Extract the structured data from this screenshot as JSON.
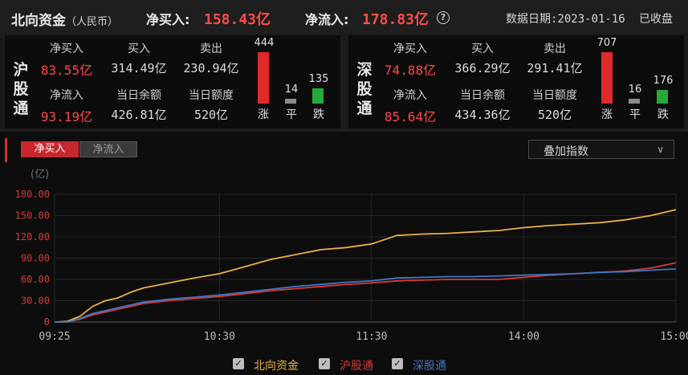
{
  "header": {
    "title": "北向资金",
    "title_suffix": "（人民币）",
    "net_buy_label": "净买入:",
    "net_buy_value": "158.43亿",
    "net_inflow_label": "净流入:",
    "net_inflow_value": "178.83亿",
    "date_label": "数据日期:2023-01-16",
    "status": "已收盘"
  },
  "sh": {
    "name": "沪股通",
    "net_buy_label": "净买入",
    "net_buy": "83.55亿",
    "buy_label": "买入",
    "buy": "314.49亿",
    "sell_label": "卖出",
    "sell": "230.94亿",
    "net_inflow_label": "净流入",
    "net_inflow": "93.19亿",
    "balance_label": "当日余额",
    "balance": "426.81亿",
    "quota_label": "当日额度",
    "quota": "520亿",
    "up": "444",
    "flat": "14",
    "down": "135",
    "up_label": "涨",
    "flat_label": "平",
    "down_label": "跌"
  },
  "sz": {
    "name": "深股通",
    "net_buy_label": "净买入",
    "net_buy": "74.88亿",
    "buy_label": "买入",
    "buy": "366.29亿",
    "sell_label": "卖出",
    "sell": "291.41亿",
    "net_inflow_label": "净流入",
    "net_inflow": "85.64亿",
    "balance_label": "当日余额",
    "balance": "434.36亿",
    "quota_label": "当日额度",
    "quota": "520亿",
    "up": "707",
    "flat": "16",
    "down": "176",
    "up_label": "涨",
    "flat_label": "平",
    "down_label": "跌"
  },
  "controls": {
    "tab_net_buy": "净买入",
    "tab_net_inflow": "净流入",
    "overlay_index": "叠加指数"
  },
  "colors": {
    "up": "#e02a2a",
    "flat": "#8a8a8a",
    "down": "#27a83a",
    "north": "#e8b04a",
    "sh": "#d63a3a",
    "sz": "#3e78c4"
  },
  "chart_data": {
    "type": "line",
    "ylabel": "(亿)",
    "ylim": [
      0,
      180
    ],
    "yticks": [
      "180.00",
      "150.00",
      "120.00",
      "90.00",
      "60.00",
      "30.00",
      "0"
    ],
    "xticks": [
      "09:25",
      "10:30",
      "11:30",
      "14:00",
      "15:00"
    ],
    "x": [
      "09:25",
      "09:30",
      "09:35",
      "09:40",
      "09:45",
      "09:50",
      "09:55",
      "10:00",
      "10:10",
      "10:20",
      "10:30",
      "10:40",
      "10:50",
      "11:00",
      "11:10",
      "11:20",
      "11:30",
      "13:10",
      "13:20",
      "13:30",
      "13:40",
      "13:50",
      "14:00",
      "14:10",
      "14:20",
      "14:30",
      "14:40",
      "14:50",
      "15:00"
    ],
    "series": [
      {
        "name": "北向资金",
        "values": [
          0,
          1,
          8,
          22,
          30,
          34,
          42,
          48,
          55,
          62,
          68,
          78,
          88,
          95,
          102,
          105,
          110,
          122,
          124,
          125,
          127,
          129,
          133,
          136,
          138,
          140,
          144,
          150,
          158.43
        ]
      },
      {
        "name": "沪股通",
        "values": [
          0,
          0,
          4,
          10,
          14,
          18,
          22,
          26,
          30,
          33,
          36,
          40,
          44,
          47,
          50,
          53,
          55,
          58,
          59,
          60,
          60,
          60,
          63,
          66,
          68,
          70,
          72,
          76,
          83.55
        ]
      },
      {
        "name": "深股通",
        "values": [
          0,
          0,
          5,
          12,
          16,
          20,
          24,
          28,
          32,
          35,
          38,
          42,
          46,
          50,
          53,
          56,
          58,
          62,
          63,
          64,
          64,
          65,
          66,
          67,
          68,
          70,
          71,
          73,
          74.88
        ]
      }
    ]
  }
}
